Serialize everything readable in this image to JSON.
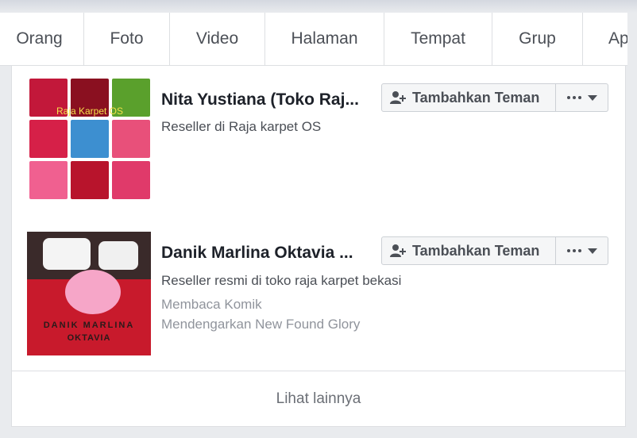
{
  "tabs": [
    "Orang",
    "Foto",
    "Video",
    "Halaman",
    "Tempat",
    "Grup",
    "Ap"
  ],
  "results": [
    {
      "name": "Nita Yustiana (Toko Raj...",
      "subtitle": "Reseller di Raja karpet OS",
      "thumb_caption": "Raja Karpet OS",
      "add_label": "Tambahkan Teman",
      "meta": []
    },
    {
      "name": "Danik Marlina Oktavia ...",
      "subtitle": "Reseller resmi di toko raja karpet bekasi",
      "thumb_caption_1": "DANIK MARLINA",
      "thumb_caption_2": "OKTAVIA",
      "add_label": "Tambahkan Teman",
      "meta": [
        "Membaca Komik",
        "Mendengarkan New Found Glory"
      ]
    }
  ],
  "see_more": "Lihat lainnya",
  "colors": {
    "button_bg": "#f5f6f7",
    "text_dark": "#1d2129",
    "text_muted": "#90949c"
  }
}
